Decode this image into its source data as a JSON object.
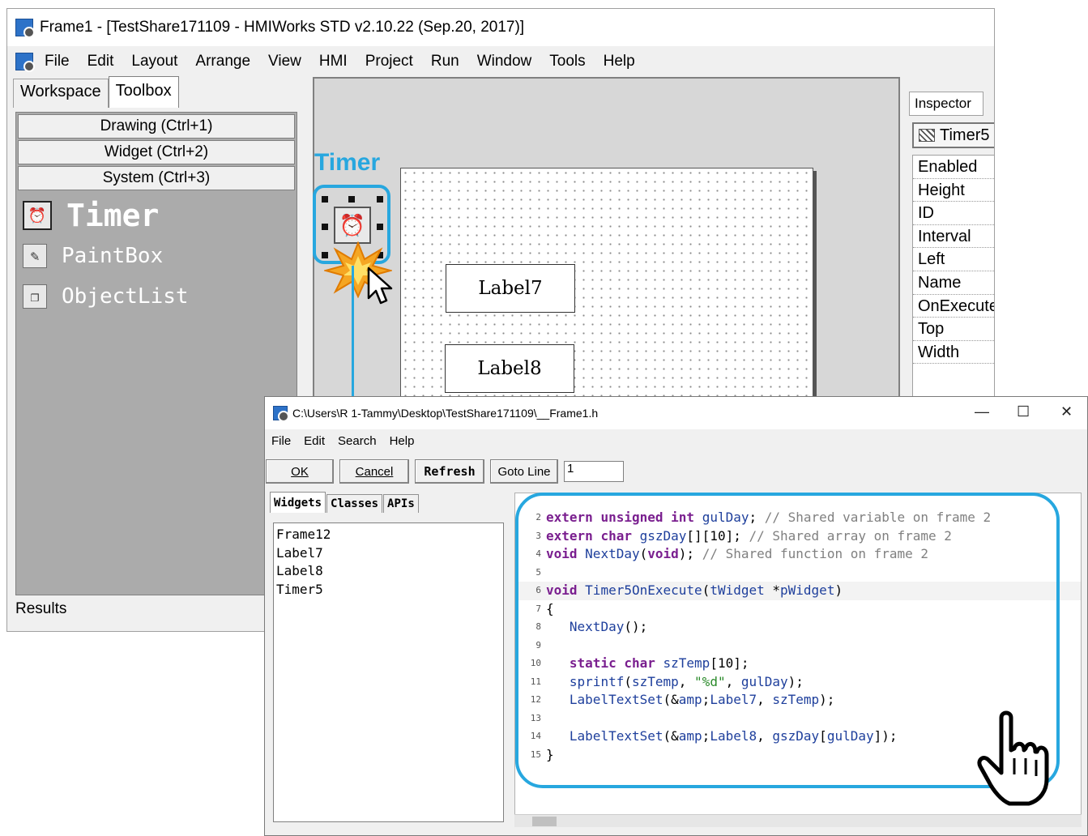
{
  "main_window": {
    "title": "Frame1 - [TestShare171109 - HMIWorks STD v2.10.22 (Sep.20, 2017)]",
    "menu": [
      "File",
      "Edit",
      "Layout",
      "Arrange",
      "View",
      "HMI",
      "Project",
      "Run",
      "Window",
      "Tools",
      "Help"
    ],
    "left_tabs": [
      "Workspace",
      "Toolbox"
    ],
    "active_left_tab": "Toolbox",
    "categories": [
      "Drawing (Ctrl+1)",
      "Widget (Ctrl+2)",
      "System (Ctrl+3)"
    ],
    "tools": [
      {
        "label": "Timer",
        "icon": "timer-icon",
        "selected": true
      },
      {
        "label": "PaintBox",
        "icon": "paintbox-icon",
        "selected": false
      },
      {
        "label": "ObjectList",
        "icon": "objectlist-icon",
        "selected": false
      }
    ],
    "results_label": "Results",
    "canvas_labels": [
      "Label7",
      "Label8"
    ],
    "inspector": {
      "tab": "Inspector",
      "object": "Timer5",
      "properties": [
        "Enabled",
        "Height",
        "ID",
        "Interval",
        "Left",
        "Name",
        "OnExecute",
        "Top",
        "Width"
      ]
    }
  },
  "callout": {
    "timer_text": "Timer",
    "accent_color": "#27a7df"
  },
  "editor": {
    "title": "C:\\Users\\R 1-Tammy\\Desktop\\TestShare171109\\__Frame1.h",
    "menu": [
      "File",
      "Edit",
      "Search",
      "Help"
    ],
    "buttons": {
      "ok": "OK",
      "cancel": "Cancel",
      "refresh": "Refresh",
      "goto": "Goto Line"
    },
    "goto_value": "1",
    "side_tabs": [
      "Widgets",
      "Classes",
      "APIs"
    ],
    "widgets": [
      "Frame12",
      "Label7",
      "Label8",
      "Timer5"
    ],
    "code": [
      {
        "n": "2",
        "text": "extern unsigned int gulDay; // Shared variable on frame 2"
      },
      {
        "n": "3",
        "text": "extern char gszDay[][10]; // Shared array on frame 2"
      },
      {
        "n": "4",
        "text": "void NextDay(void); // Shared function on frame 2"
      },
      {
        "n": "5",
        "text": ""
      },
      {
        "n": "6",
        "text": "void Timer5OnExecute(tWidget *pWidget)"
      },
      {
        "n": "7",
        "text": "{"
      },
      {
        "n": "8",
        "text": "   NextDay();"
      },
      {
        "n": "9",
        "text": ""
      },
      {
        "n": "10",
        "text": "   static char szTemp[10];"
      },
      {
        "n": "11",
        "text": "   sprintf(szTemp, \"%d\", gulDay);"
      },
      {
        "n": "12",
        "text": "   LabelTextSet(&Label7, szTemp);"
      },
      {
        "n": "13",
        "text": ""
      },
      {
        "n": "14",
        "text": "   LabelTextSet(&Label8, gszDay[gulDay]);"
      },
      {
        "n": "15",
        "text": "}"
      }
    ]
  }
}
